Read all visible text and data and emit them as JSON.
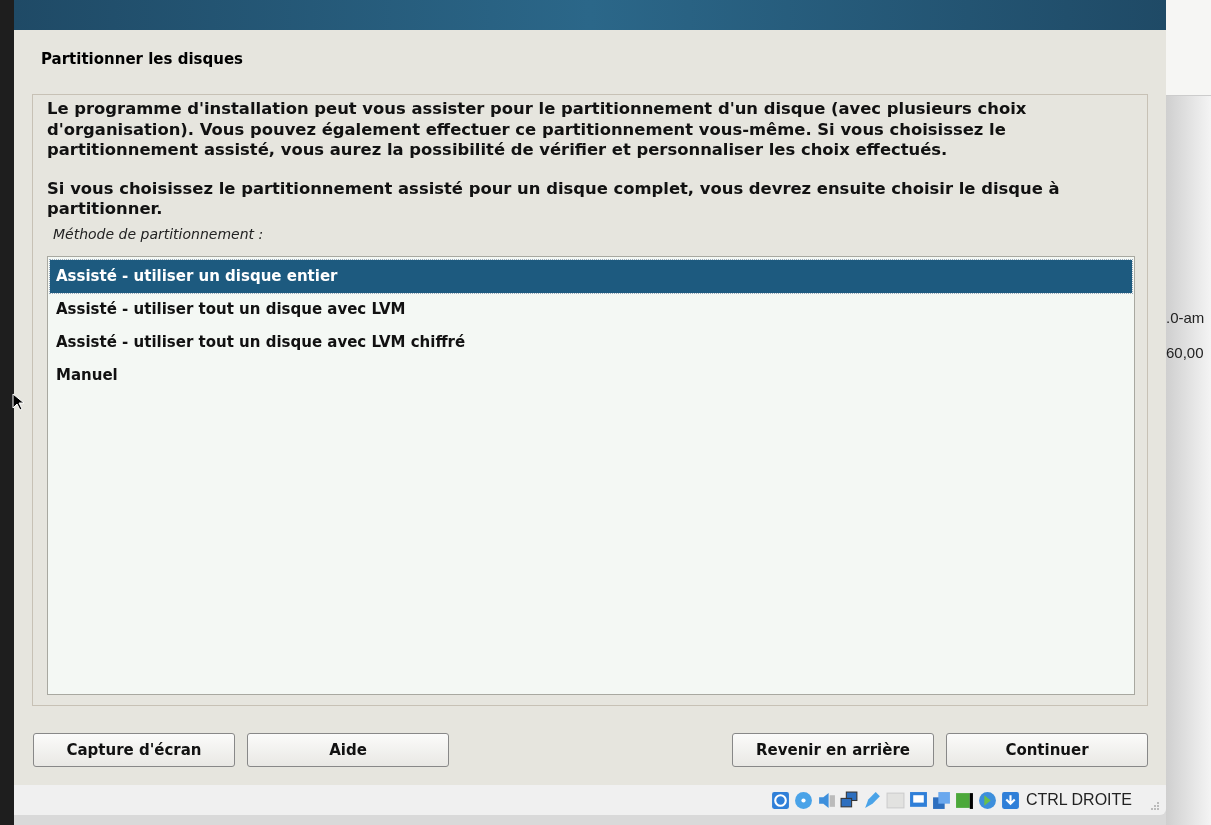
{
  "dialog": {
    "title": "Partitionner les disques",
    "paragraphs": [
      "Le programme d'installation peut vous assister pour le partitionnement d'un disque (avec plusieurs choix d'organisation). Vous pouvez également effectuer ce partitionnement vous-même. Si vous choisissez le partitionnement assisté, vous aurez la possibilité de vérifier et personnaliser les choix effectués.",
      "Si vous choisissez le partitionnement assisté pour un disque complet, vous devrez ensuite choisir le disque à partitionner."
    ],
    "list_label": "Méthode de partitionnement :",
    "options": [
      {
        "label": "Assisté - utiliser un disque entier",
        "selected": true
      },
      {
        "label": "Assisté - utiliser tout un disque avec LVM",
        "selected": false
      },
      {
        "label": "Assisté - utiliser tout un disque avec LVM chiffré",
        "selected": false
      },
      {
        "label": "Manuel",
        "selected": false
      }
    ],
    "left_buttons": [
      "Capture d'écran",
      "Aide"
    ],
    "right_buttons": [
      "Revenir en arrière",
      "Continuer"
    ]
  },
  "status_bar": {
    "host_key": "CTRL DROITE"
  },
  "background_texts": [
    ".0-am",
    "60,00"
  ]
}
